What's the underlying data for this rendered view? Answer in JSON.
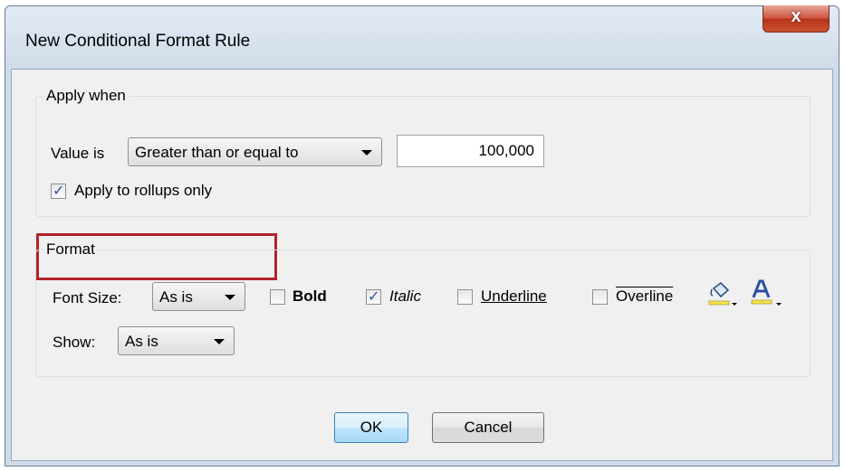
{
  "dialog": {
    "title": "New Conditional Format Rule",
    "close_label": "x"
  },
  "apply_when": {
    "group_label": "Apply when",
    "value_is_label": "Value is",
    "condition_selected": "Greater than or equal to",
    "value": "100,000",
    "rollups_label": "Apply to rollups only",
    "rollups_checked": true
  },
  "format": {
    "group_label": "Format",
    "font_size_label": "Font Size:",
    "font_size_selected": "As is",
    "bold_label": "Bold",
    "bold_checked": false,
    "italic_label": "Italic",
    "italic_checked": true,
    "underline_label": "Underline",
    "underline_checked": false,
    "overline_label": "Overline",
    "overline_checked": false,
    "show_label": "Show:",
    "show_selected": "As is",
    "fill_color_icon": "paint-bucket-icon",
    "font_color_icon": "font-color-icon",
    "fill_color": "#f4e04d",
    "font_color": "#2a4fa0"
  },
  "buttons": {
    "ok": "OK",
    "cancel": "Cancel"
  },
  "colors": {
    "highlight_border": "#b0252a",
    "close_button": "#c9452c"
  }
}
